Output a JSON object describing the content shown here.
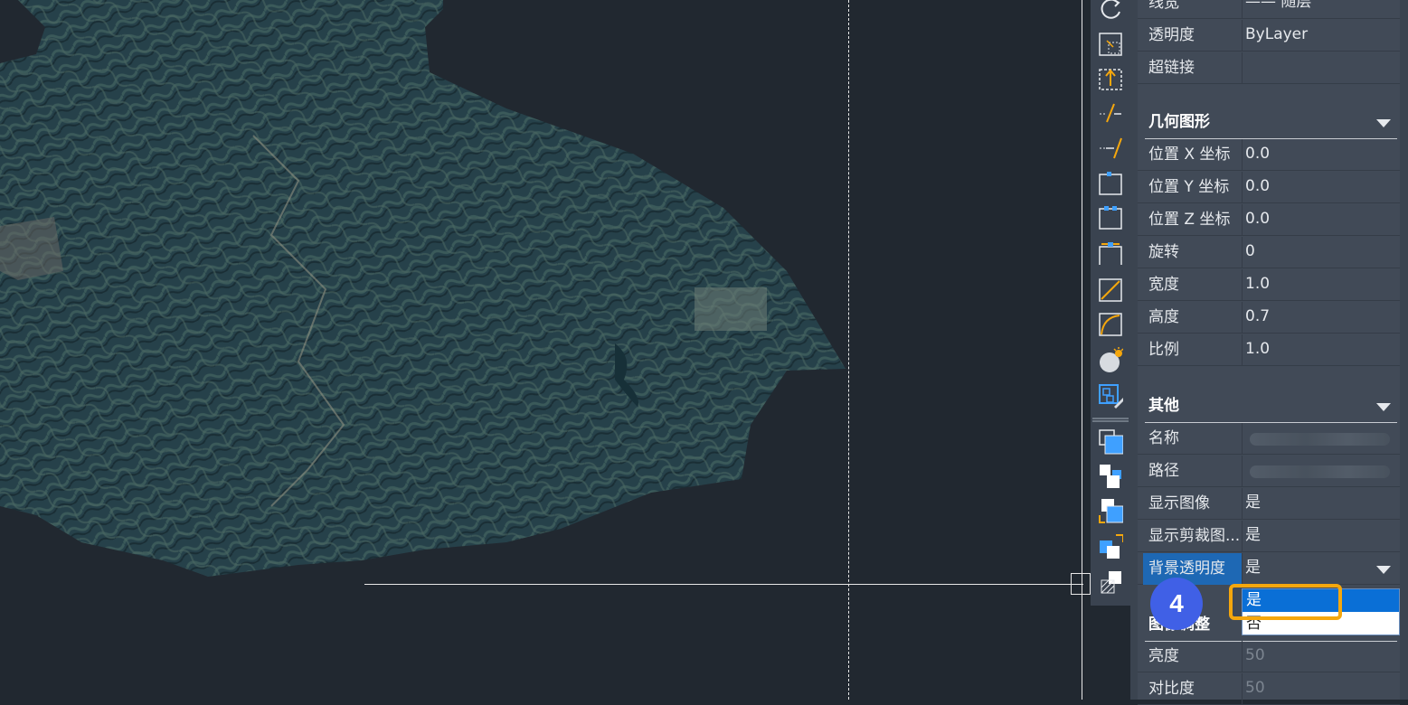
{
  "properties": {
    "general_rows": [
      {
        "label": "线宽",
        "value": "—— 随层"
      },
      {
        "label": "透明度",
        "value": "ByLayer"
      },
      {
        "label": "超链接",
        "value": ""
      }
    ],
    "geometry": {
      "title": "几何图形",
      "rows": [
        {
          "label": "位置 X 坐标",
          "value": "0.0"
        },
        {
          "label": "位置 Y 坐标",
          "value": "0.0"
        },
        {
          "label": "位置 Z 坐标",
          "value": "0.0"
        },
        {
          "label": "旋转",
          "value": "0"
        },
        {
          "label": "宽度",
          "value": "1.0"
        },
        {
          "label": "高度",
          "value": "0.7"
        },
        {
          "label": "比例",
          "value": "1.0"
        }
      ]
    },
    "misc": {
      "title": "其他",
      "rows": [
        {
          "label": "名称",
          "value": ""
        },
        {
          "label": "路径",
          "value": ""
        },
        {
          "label": "显示图像",
          "value": "是"
        },
        {
          "label": "显示剪裁图...",
          "value": "是"
        },
        {
          "label": "背景透明度",
          "value": "是"
        }
      ]
    },
    "adjust": {
      "title": "图像调整",
      "rows": [
        {
          "label": "亮度",
          "value": "50"
        },
        {
          "label": "对比度",
          "value": "50"
        }
      ]
    }
  },
  "dropdown": {
    "options": [
      "是",
      "否"
    ],
    "selected": "是"
  },
  "step_badge": "4",
  "toolbar": {
    "icons": [
      "rotate-icon",
      "scale-icon",
      "stretch-icon",
      "break-icon",
      "join-icon",
      "align-left-icon",
      "align-top-icon",
      "align-distribute-icon",
      "line-icon",
      "arc-icon",
      "render-light-icon",
      "block-editor-icon",
      "bring-front-icon",
      "send-back-icon",
      "bring-above-icon",
      "send-under-icon",
      "wipeout-icon"
    ]
  }
}
